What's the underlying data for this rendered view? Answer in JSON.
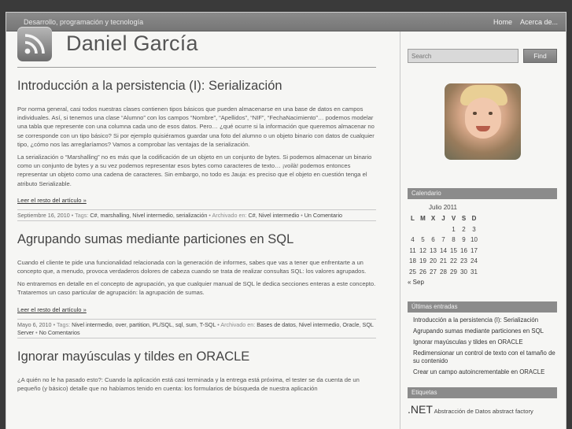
{
  "topbar": {
    "tagline": "Desarrollo, programación y tecnología",
    "nav": [
      "Home",
      "Acerca de..."
    ]
  },
  "site": {
    "title": "Daniel García"
  },
  "posts": [
    {
      "title": "Introducción a la persistencia (I): Serialización",
      "paragraphs": [
        "Por norma general, casi todos nuestras clases contienen tipos básicos que pueden almacenarse en una base de datos en campos individuales. Así, si tenemos una clase “Alumno” con los campos “Nombre”, “Apellidos”, “NIF”, “FechaNacimiento”… podemos modelar una tabla que represente con una columna cada uno de esos datos. Pero… ¿qué ocurre si la información que queremos almacenar no se corresponde con un tipo básico? Si por ejemplo quisiéramos guardar una foto del alumno o un objeto binario con datos de cualquier tipo, ¿cómo nos las arreglaríamos? Vamos a comprobar las ventajas de la serialización.",
        "La serialización o “Marshalling” no es más que la codificación de un objeto en un conjunto de bytes. Si podemos almacenar un binario como un conjunto de bytes y a su vez podemos representar esos bytes como caracteres de texto… ¡voilà! podemos entonces representar un objeto como una cadena de caracteres. Sin embargo, no todo es Jauja: es preciso que el objeto en cuestión tenga el atributo Serializable."
      ],
      "read_more": "Leer el resto del artículo »",
      "meta": {
        "date": "Septiembre 16, 2010",
        "tags_label": "Tags:",
        "tags": [
          "C#",
          "marshalling",
          "Nivel intermedio",
          "serialización"
        ],
        "archived_label": "Archivado en:",
        "categories": [
          "C#",
          "Nivel intermedio"
        ],
        "comments": "Un Comentario"
      }
    },
    {
      "title": "Agrupando sumas mediante particiones en SQL",
      "paragraphs": [
        "Cuando el cliente te pide una funcionalidad relacionada con la generación de informes, sabes que vas a tener que enfrentarte a un concepto que, a menudo, provoca verdaderos dolores de cabeza cuando se trata de realizar consultas SQL: los valores agrupados.",
        "No entraremos en detalle en el concepto de agrupación, ya que cualquier manual de SQL le dedica secciones enteras a este concepto. Trataremos un caso particular de agrupación: la agrupación de sumas."
      ],
      "read_more": "Leer el resto del artículo »",
      "meta": {
        "date": "Mayo 6, 2010",
        "tags_label": "Tags:",
        "tags": [
          "Nivel intermedio",
          "over",
          "partition",
          "PL/SQL",
          "sql",
          "sum",
          "T-SQL"
        ],
        "archived_label": "Archivado en:",
        "categories": [
          "Bases de datos",
          "Nivel intermedio",
          "Oracle",
          "SQL Server"
        ],
        "comments": "No Comentarios"
      }
    },
    {
      "title": "Ignorar mayúsculas y tildes en ORACLE",
      "paragraphs": [
        "¿A quién no le ha pasado esto?: Cuando la aplicación está casi terminada y la entrega está próxima, el tester se da cuenta de un pequeño (y básico) detalle que no habíamos tenido en cuenta: los formularios de búsqueda de nuestra aplicación"
      ]
    }
  ],
  "search": {
    "placeholder": "Search",
    "button": "Find"
  },
  "calendar": {
    "title": "Calendario",
    "month": "Julio 2011",
    "weekdays": [
      "L",
      "M",
      "X",
      "J",
      "V",
      "S",
      "D"
    ],
    "weeks": [
      [
        "",
        "",
        "",
        "",
        "1",
        "2",
        "3"
      ],
      [
        "4",
        "5",
        "6",
        "7",
        "8",
        "9",
        "10"
      ],
      [
        "11",
        "12",
        "13",
        "14",
        "15",
        "16",
        "17"
      ],
      [
        "18",
        "19",
        "20",
        "21",
        "22",
        "23",
        "24"
      ],
      [
        "25",
        "26",
        "27",
        "28",
        "29",
        "30",
        "31"
      ]
    ],
    "prev": "« Sep"
  },
  "recent": {
    "title": "Últimas entradas",
    "items": [
      "Introducción a la persistencia (I): Serialización",
      "Agrupando sumas mediante particiones en SQL",
      "Ignorar mayúsculas y tildes en ORACLE",
      "Redimensionar un control de texto con el tamaño de su contenido",
      "Crear un campo autoincrementable en ORACLE"
    ]
  },
  "tags_widget": {
    "title": "Etiquetas",
    "big": ".NET",
    "rest": "Abstracción de Datos abstract factory"
  },
  "colors": {
    "topbar": "#7f7f7f",
    "background": "#f6f6f4",
    "widget_header": "#8b8b8b"
  },
  "icons": {
    "feed": "rss-icon"
  }
}
